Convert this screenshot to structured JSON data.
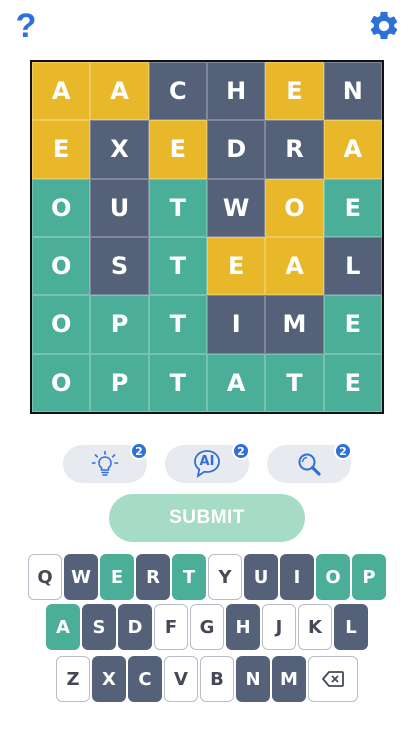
{
  "help_label": "?",
  "board": [
    [
      {
        "l": "A",
        "c": "y"
      },
      {
        "l": "A",
        "c": "y"
      },
      {
        "l": "C",
        "c": "s"
      },
      {
        "l": "H",
        "c": "s"
      },
      {
        "l": "E",
        "c": "y"
      },
      {
        "l": "N",
        "c": "s"
      }
    ],
    [
      {
        "l": "E",
        "c": "y"
      },
      {
        "l": "X",
        "c": "s"
      },
      {
        "l": "E",
        "c": "y"
      },
      {
        "l": "D",
        "c": "s"
      },
      {
        "l": "R",
        "c": "s"
      },
      {
        "l": "A",
        "c": "y"
      }
    ],
    [
      {
        "l": "O",
        "c": "g"
      },
      {
        "l": "U",
        "c": "s"
      },
      {
        "l": "T",
        "c": "g"
      },
      {
        "l": "W",
        "c": "s"
      },
      {
        "l": "O",
        "c": "y"
      },
      {
        "l": "E",
        "c": "g"
      }
    ],
    [
      {
        "l": "O",
        "c": "g"
      },
      {
        "l": "S",
        "c": "s"
      },
      {
        "l": "T",
        "c": "g"
      },
      {
        "l": "E",
        "c": "y"
      },
      {
        "l": "A",
        "c": "y"
      },
      {
        "l": "L",
        "c": "s"
      }
    ],
    [
      {
        "l": "O",
        "c": "g"
      },
      {
        "l": "P",
        "c": "g"
      },
      {
        "l": "T",
        "c": "g"
      },
      {
        "l": "I",
        "c": "s"
      },
      {
        "l": "M",
        "c": "s"
      },
      {
        "l": "E",
        "c": "g"
      }
    ],
    [
      {
        "l": "O",
        "c": "g"
      },
      {
        "l": "P",
        "c": "g"
      },
      {
        "l": "T",
        "c": "g"
      },
      {
        "l": "A",
        "c": "g"
      },
      {
        "l": "T",
        "c": "g"
      },
      {
        "l": "E",
        "c": "g"
      }
    ]
  ],
  "hints": {
    "bulb_count": "2",
    "ai_label": "AI",
    "ai_count": "2",
    "search_count": "2"
  },
  "submit_label": "SUBMIT",
  "keyboard": [
    [
      {
        "k": "Q",
        "c": "w"
      },
      {
        "k": "W",
        "c": "s"
      },
      {
        "k": "E",
        "c": "g"
      },
      {
        "k": "R",
        "c": "s"
      },
      {
        "k": "T",
        "c": "g"
      },
      {
        "k": "Y",
        "c": "w"
      },
      {
        "k": "U",
        "c": "s"
      },
      {
        "k": "I",
        "c": "s"
      },
      {
        "k": "O",
        "c": "g"
      },
      {
        "k": "P",
        "c": "g"
      }
    ],
    [
      {
        "k": "A",
        "c": "g"
      },
      {
        "k": "S",
        "c": "s"
      },
      {
        "k": "D",
        "c": "s"
      },
      {
        "k": "F",
        "c": "w"
      },
      {
        "k": "G",
        "c": "w"
      },
      {
        "k": "H",
        "c": "s"
      },
      {
        "k": "J",
        "c": "w"
      },
      {
        "k": "K",
        "c": "w"
      },
      {
        "k": "L",
        "c": "s"
      }
    ],
    [
      {
        "k": "Z",
        "c": "w"
      },
      {
        "k": "X",
        "c": "s"
      },
      {
        "k": "C",
        "c": "s"
      },
      {
        "k": "V",
        "c": "w"
      },
      {
        "k": "B",
        "c": "w"
      },
      {
        "k": "N",
        "c": "s"
      },
      {
        "k": "M",
        "c": "s"
      }
    ]
  ],
  "colors": {
    "yellow": "#e8b82a",
    "slate": "#546178",
    "green": "#4bae98",
    "accent": "#2f6fd8",
    "submit": "#a6dcc6"
  },
  "icons": {
    "help": "question-mark-icon",
    "settings": "gear-icon",
    "hint1": "lightbulb-icon",
    "hint2": "ai-bubble-icon",
    "hint3": "magnifier-icon",
    "delete": "backspace-icon"
  }
}
